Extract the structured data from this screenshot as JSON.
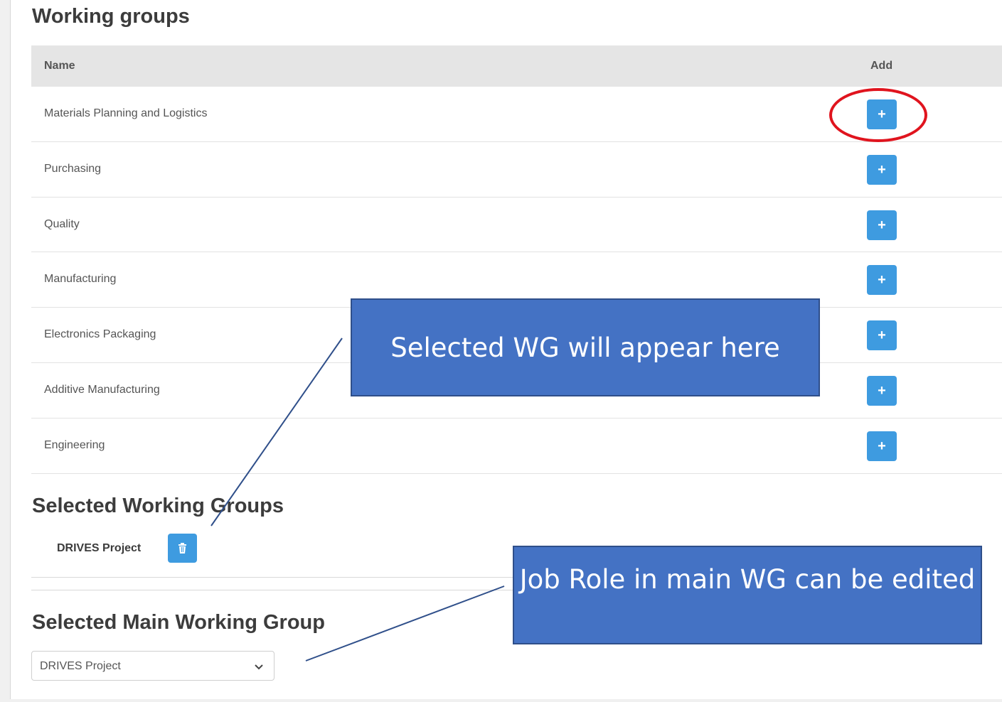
{
  "working_groups": {
    "title": "Working groups",
    "columns": {
      "name": "Name",
      "add": "Add"
    },
    "rows": [
      {
        "name": "Materials Planning and Logistics"
      },
      {
        "name": "Purchasing"
      },
      {
        "name": "Quality"
      },
      {
        "name": "Manufacturing"
      },
      {
        "name": "Electronics Packaging"
      },
      {
        "name": "Additive Manufacturing"
      },
      {
        "name": "Engineering"
      }
    ],
    "add_label": "+"
  },
  "selected": {
    "title": "Selected Working Groups",
    "items": [
      {
        "name": "DRIVES Project"
      }
    ]
  },
  "main_group": {
    "title": "Selected Main Working Group",
    "selected_value": "DRIVES Project"
  },
  "annotations": {
    "callout_1": "Selected WG will appear here",
    "callout_2": "Job Role in main WG can be edited"
  },
  "colors": {
    "accent": "#3e9be0",
    "callout": "#4472c4",
    "highlight": "#e0141e"
  }
}
